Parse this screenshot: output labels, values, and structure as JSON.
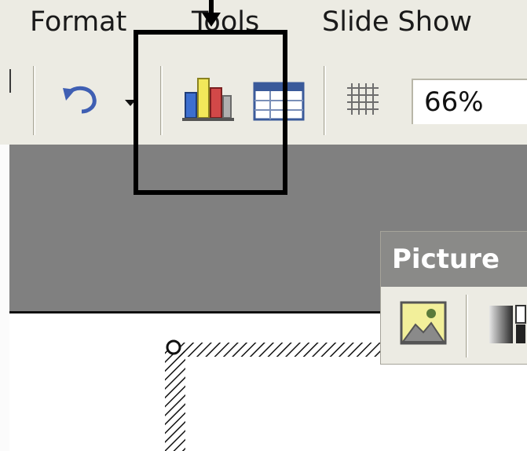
{
  "menu": {
    "items": [
      {
        "label": "Format"
      },
      {
        "label": "Tools"
      },
      {
        "label": "Slide Show"
      }
    ]
  },
  "toolbar": {
    "undo_icon": "undo-icon",
    "undo_dropdown_icon": "chevron-down-icon",
    "chart_icon": "insert-chart-icon",
    "table_icon": "insert-table-icon",
    "grid_icon": "show-grid-icon",
    "zoom_value": "66%"
  },
  "picture_toolbar": {
    "title": "Picture",
    "insert_picture_icon": "insert-picture-icon",
    "color_icon": "image-color-icon"
  },
  "annotation": {
    "box_color": "#000000",
    "arrow_color": "#000000"
  },
  "colors": {
    "toolbar_bg": "#ecebe3",
    "workspace": "#808080",
    "palette_title": "#8a8a88"
  }
}
